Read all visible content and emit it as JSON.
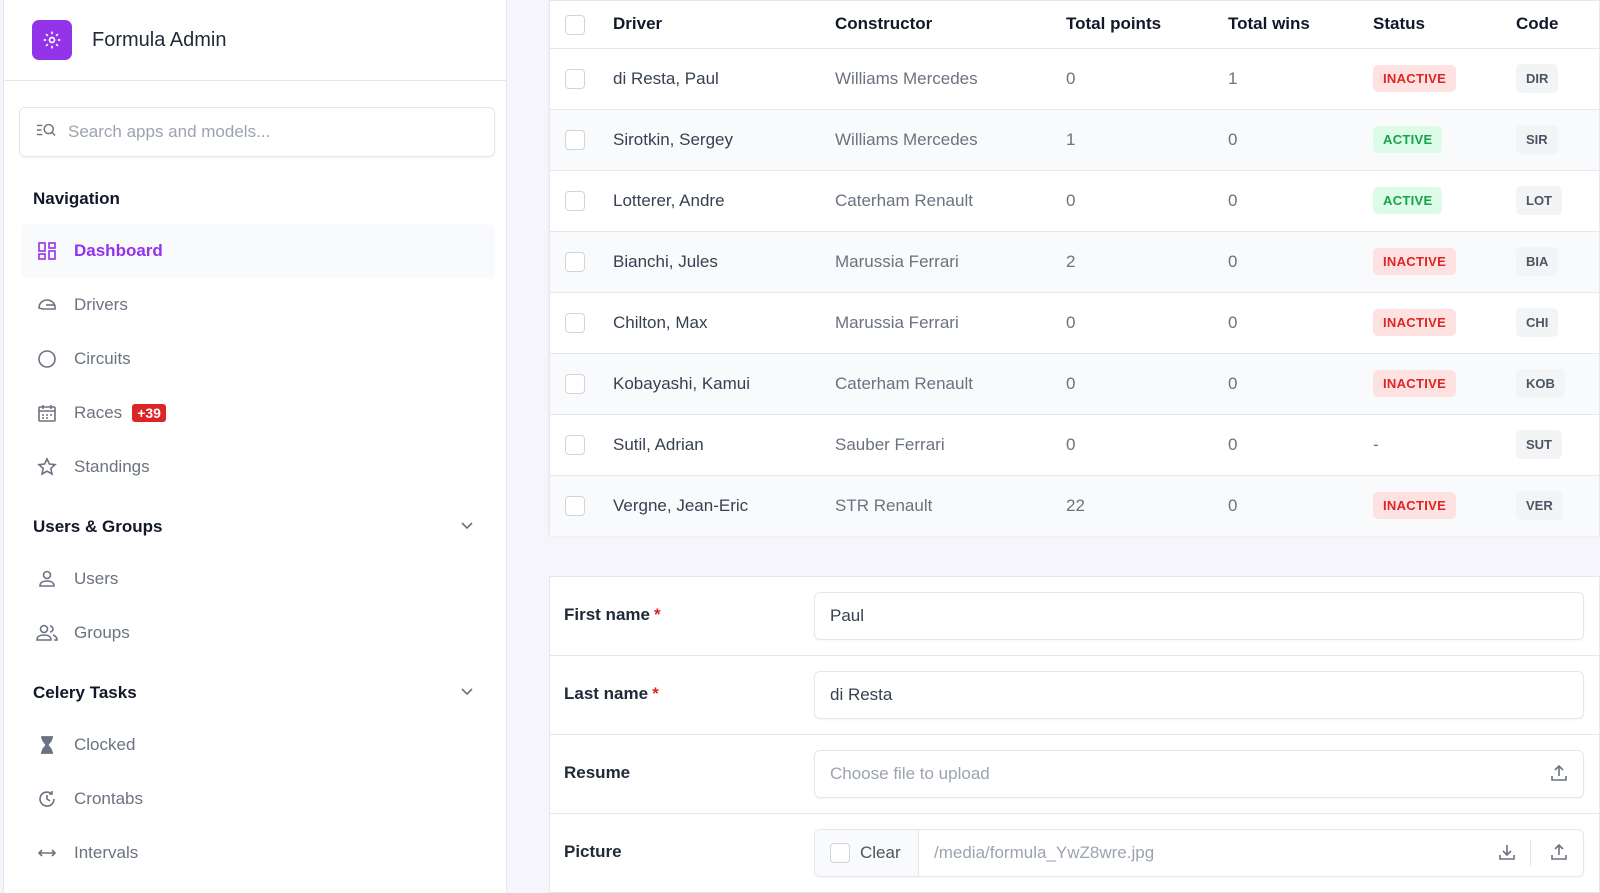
{
  "app": {
    "title": "Formula Admin",
    "logo_icon": "gear-icon",
    "accent": "#9333ea"
  },
  "search": {
    "placeholder": "Search apps and models..."
  },
  "sidebar": {
    "navigation_title": "Navigation",
    "navigation": [
      {
        "label": "Dashboard",
        "icon": "dashboard-icon",
        "active": true
      },
      {
        "label": "Drivers",
        "icon": "helmet-icon"
      },
      {
        "label": "Circuits",
        "icon": "circle-icon"
      },
      {
        "label": "Races",
        "icon": "calendar-icon",
        "badge": "+39"
      },
      {
        "label": "Standings",
        "icon": "star-icon"
      }
    ],
    "users_title": "Users & Groups",
    "users": [
      {
        "label": "Users",
        "icon": "user-icon"
      },
      {
        "label": "Groups",
        "icon": "group-icon"
      }
    ],
    "celery_title": "Celery Tasks",
    "celery": [
      {
        "label": "Clocked",
        "icon": "hourglass-icon"
      },
      {
        "label": "Crontabs",
        "icon": "clock-icon"
      },
      {
        "label": "Intervals",
        "icon": "arrows-icon"
      }
    ]
  },
  "table": {
    "headers": {
      "driver": "Driver",
      "constructor": "Constructor",
      "points": "Total points",
      "wins": "Total wins",
      "status": "Status",
      "code": "Code"
    },
    "rows": [
      {
        "driver": "di Resta, Paul",
        "constructor": "Williams Mercedes",
        "points": "0",
        "wins": "1",
        "status": "INACTIVE",
        "code": "DIR"
      },
      {
        "driver": "Sirotkin, Sergey",
        "constructor": "Williams Mercedes",
        "points": "1",
        "wins": "0",
        "status": "ACTIVE",
        "code": "SIR"
      },
      {
        "driver": "Lotterer, Andre",
        "constructor": "Caterham Renault",
        "points": "0",
        "wins": "0",
        "status": "ACTIVE",
        "code": "LOT"
      },
      {
        "driver": "Bianchi, Jules",
        "constructor": "Marussia Ferrari",
        "points": "2",
        "wins": "0",
        "status": "INACTIVE",
        "code": "BIA"
      },
      {
        "driver": "Chilton, Max",
        "constructor": "Marussia Ferrari",
        "points": "0",
        "wins": "0",
        "status": "INACTIVE",
        "code": "CHI"
      },
      {
        "driver": "Kobayashi, Kamui",
        "constructor": "Caterham Renault",
        "points": "0",
        "wins": "0",
        "status": "INACTIVE",
        "code": "KOB"
      },
      {
        "driver": "Sutil, Adrian",
        "constructor": "Sauber Ferrari",
        "points": "0",
        "wins": "0",
        "status": "-",
        "code": "SUT"
      },
      {
        "driver": "Vergne, Jean-Eric",
        "constructor": "STR Renault",
        "points": "22",
        "wins": "0",
        "status": "INACTIVE",
        "code": "VER"
      }
    ]
  },
  "form": {
    "first_name_label": "First name",
    "first_name_value": "Paul",
    "last_name_label": "Last name",
    "last_name_value": "di Resta",
    "required_mark": "*",
    "resume_label": "Resume",
    "resume_placeholder": "Choose file to upload",
    "picture_label": "Picture",
    "clear_label": "Clear",
    "picture_path": "/media/formula_YwZ8wre.jpg"
  }
}
